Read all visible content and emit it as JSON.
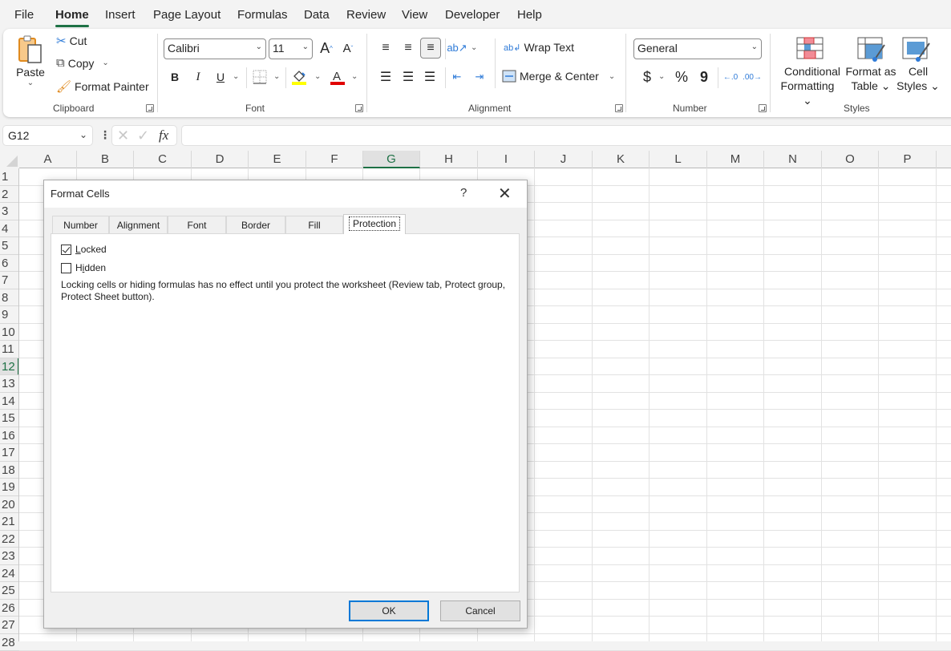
{
  "menu": {
    "tabs": [
      "File",
      "Home",
      "Insert",
      "Page Layout",
      "Formulas",
      "Data",
      "Review",
      "View",
      "Developer",
      "Help"
    ],
    "active": "Home"
  },
  "ribbon": {
    "clipboard": {
      "label": "Clipboard",
      "paste": "Paste",
      "cut": "Cut",
      "copy": "Copy",
      "format_painter": "Format Painter"
    },
    "font": {
      "label": "Font",
      "font_name": "Calibri",
      "font_size": "11",
      "bold": "B",
      "italic": "I",
      "underline": "U",
      "grow": "A",
      "shrink": "A",
      "fill_color": "#ffff00",
      "font_color": "#e00000"
    },
    "alignment": {
      "label": "Alignment",
      "wrap_text": "Wrap Text",
      "merge_center": "Merge & Center"
    },
    "number": {
      "label": "Number",
      "format": "General",
      "currency": "$",
      "percent": "%",
      "comma": "9"
    },
    "styles": {
      "label": "Styles",
      "conditional_1": "Conditional",
      "conditional_2": "Formatting",
      "table_1": "Format as",
      "table_2": "Table",
      "cell_1": "Cell",
      "cell_2": "Styles"
    }
  },
  "formula_bar": {
    "name_box": "G12",
    "fx": "fx",
    "value": ""
  },
  "sheet": {
    "columns": [
      "A",
      "B",
      "C",
      "D",
      "E",
      "F",
      "G",
      "H",
      "I",
      "J",
      "K",
      "L",
      "M",
      "N",
      "O",
      "P"
    ],
    "rows": [
      "1",
      "2",
      "3",
      "4",
      "5",
      "6",
      "7",
      "8",
      "9",
      "10",
      "11",
      "12",
      "13",
      "14",
      "15",
      "16",
      "17",
      "18",
      "19",
      "20",
      "21",
      "22",
      "23",
      "24",
      "25",
      "26",
      "27",
      "28"
    ],
    "selected_column": "G",
    "selected_row": "12"
  },
  "dialog": {
    "title": "Format Cells",
    "help": "?",
    "close": "✕",
    "tabs": [
      "Number",
      "Alignment",
      "Font",
      "Border",
      "Fill",
      "Protection"
    ],
    "active_tab": "Protection",
    "locked": {
      "label_u": "L",
      "label_rest": "ocked",
      "checked": true
    },
    "hidden": {
      "label_pre": "H",
      "label_u": "i",
      "label_rest": "dden",
      "checked": false
    },
    "note": "Locking cells or hiding formulas has no effect until you protect the worksheet (Review tab, Protect group, Protect Sheet button).",
    "ok": "OK",
    "cancel": "Cancel"
  }
}
